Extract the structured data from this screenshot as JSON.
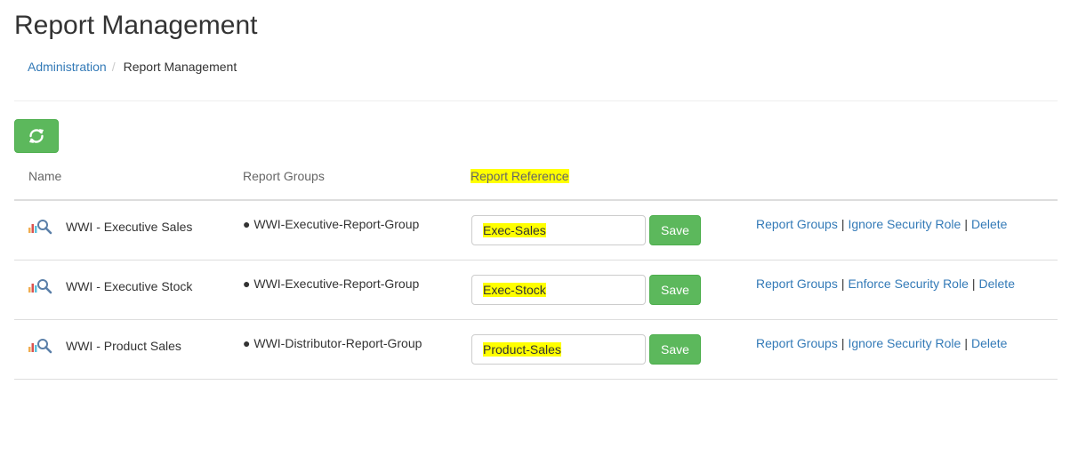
{
  "page": {
    "title": "Report Management"
  },
  "breadcrumb": {
    "parent": "Administration",
    "separator": "/",
    "current": "Report Management"
  },
  "toolbar": {
    "refresh_icon": "refresh-icon",
    "accent": "#5cb85c"
  },
  "table": {
    "headers": {
      "name": "Name",
      "groups": "Report Groups",
      "reference": "Report Reference"
    },
    "rows": [
      {
        "name": "WWI - Executive Sales",
        "group": "WWI-Executive-Report-Group",
        "reference": "Exec-Sales",
        "save": "Save",
        "actions": {
          "groups": "Report Groups",
          "security": "Ignore Security Role",
          "delete": "Delete"
        }
      },
      {
        "name": "WWI - Executive Stock",
        "group": "WWI-Executive-Report-Group",
        "reference": "Exec-Stock",
        "save": "Save",
        "actions": {
          "groups": "Report Groups",
          "security": "Enforce Security Role",
          "delete": "Delete"
        }
      },
      {
        "name": "WWI - Product Sales",
        "group": "WWI-Distributor-Report-Group",
        "reference": "Product-Sales",
        "save": "Save",
        "actions": {
          "groups": "Report Groups",
          "security": "Ignore Security Role",
          "delete": "Delete"
        }
      }
    ]
  },
  "colors": {
    "link": "#337ab7",
    "highlight": "#ffff00",
    "button": "#5cb85c"
  },
  "icons": {
    "report": "report-chart-search-icon"
  }
}
